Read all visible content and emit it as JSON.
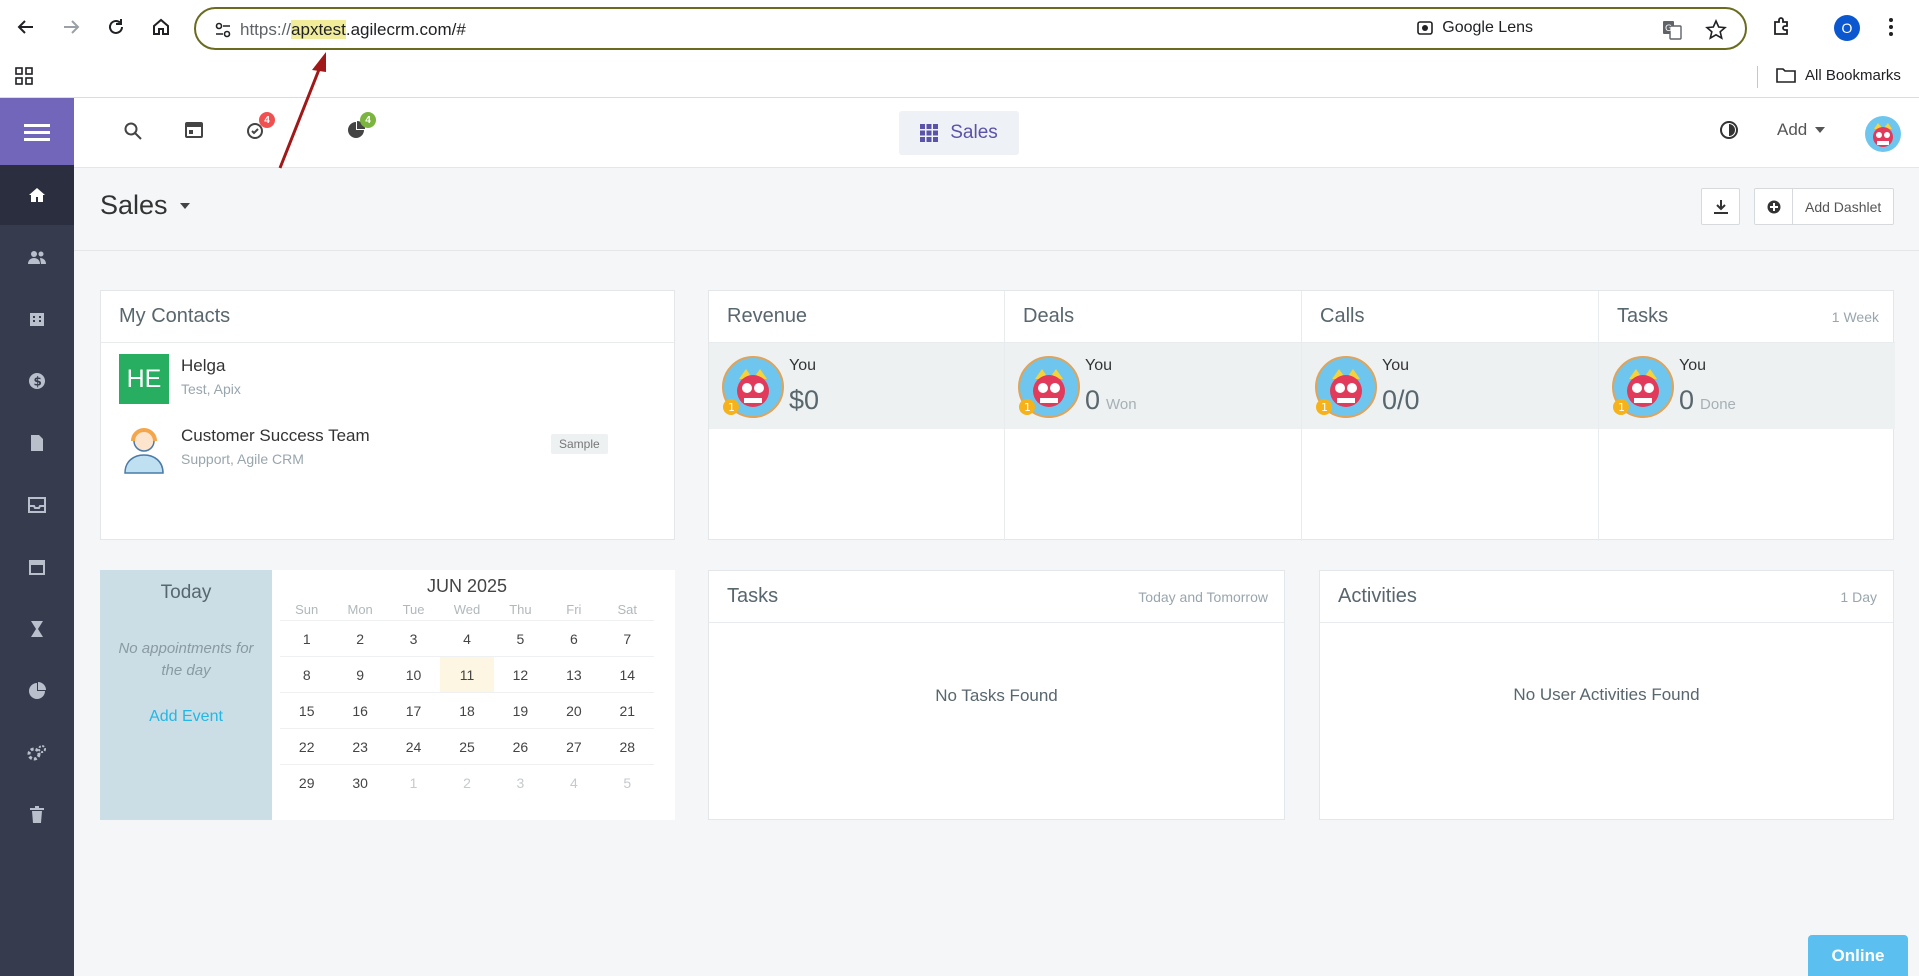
{
  "browser": {
    "url_scheme": "https://",
    "url_highlight": "apxtest",
    "url_rest": ".agilecrm.com/#",
    "lens_label": "Google Lens",
    "profile_initial": "O",
    "all_bookmarks": "All Bookmarks"
  },
  "header": {
    "badge_reminders": "4",
    "badge_reports": "4",
    "dashboard_switch_label": "Sales",
    "add_label": "Add"
  },
  "page": {
    "title": "Sales",
    "add_dashlet_label": "Add Dashlet"
  },
  "contacts_panel": {
    "title": "My Contacts",
    "items": [
      {
        "avatar": "HE",
        "name": "Helga",
        "sub": "Test, Apix"
      },
      {
        "name": "Customer Success Team",
        "sub": "Support, Agile CRM",
        "tag": "Sample"
      }
    ]
  },
  "stats_panel": {
    "period": "1 Week",
    "columns": [
      {
        "title": "Revenue",
        "who": "You",
        "value": "$0",
        "suffix": "",
        "rank": "1"
      },
      {
        "title": "Deals",
        "who": "You",
        "value": "0",
        "suffix": "Won",
        "rank": "1"
      },
      {
        "title": "Calls",
        "who": "You",
        "value": "0/0",
        "suffix": "",
        "rank": "1"
      },
      {
        "title": "Tasks",
        "who": "You",
        "value": "0",
        "suffix": "Done",
        "rank": "1"
      }
    ]
  },
  "calendar": {
    "today_label": "Today",
    "no_appointments": "No appointments for the day",
    "add_event": "Add Event",
    "month": "JUN 2025",
    "weekdays": [
      "Sun",
      "Mon",
      "Tue",
      "Wed",
      "Thu",
      "Fri",
      "Sat"
    ],
    "weeks": [
      [
        "1",
        "2",
        "3",
        "4",
        "5",
        "6",
        "7"
      ],
      [
        "8",
        "9",
        "10",
        "11",
        "12",
        "13",
        "14"
      ],
      [
        "15",
        "16",
        "17",
        "18",
        "19",
        "20",
        "21"
      ],
      [
        "22",
        "23",
        "24",
        "25",
        "26",
        "27",
        "28"
      ],
      [
        "29",
        "30",
        "1",
        "2",
        "3",
        "4",
        "5"
      ]
    ],
    "today_day": "11"
  },
  "tasks_panel": {
    "title": "Tasks",
    "sub": "Today and Tomorrow",
    "empty": "No Tasks Found"
  },
  "activities_panel": {
    "title": "Activities",
    "sub": "1 Day",
    "empty": "No User Activities Found"
  },
  "status": {
    "online_label": "Online"
  },
  "colors": {
    "sidebar": "#363b4e",
    "accent_purple": "#7266ba",
    "contact_green": "#27ae60",
    "online_blue": "#5bc0f0",
    "annotation_arrow": "#a01818"
  }
}
